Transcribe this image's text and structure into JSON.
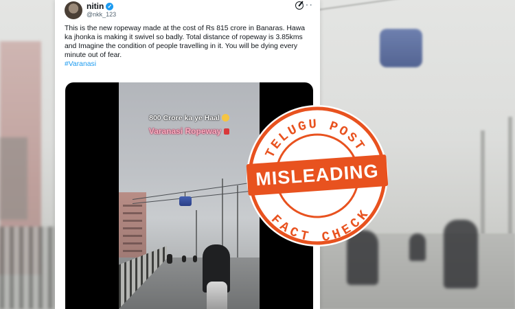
{
  "tweet": {
    "author_name": "nitin",
    "author_handle": "@nkk_123",
    "body": "This is the new ropeway made at the cost of Rs 815 crore in Banaras. Hawa ka jhonka is making it swivel so badly. Total distance of ropeway is 3.85kms and Imagine the condition of people travelling in it. You will be dying every minute out of fear.",
    "hashtag": "#Varanasi",
    "icons": {
      "verified": "verified-badge-icon",
      "grok": "grok-icon",
      "more": "more-options-icon"
    }
  },
  "video": {
    "caption_line1": "800 Crore ka ye Haal",
    "caption_line2": "Varanasi Ropeway",
    "caption_line1_emoji": "smile-emoji-icon",
    "caption_line2_emoji": "aerial-tramway-icon"
  },
  "stamp": {
    "top_text": "TELUGU POST",
    "main_label": "MISLEADING",
    "bottom_text": "FACT CHECK",
    "color": "#e8521f"
  },
  "colors": {
    "link": "#1d9bf0",
    "stamp_orange": "#e8521f"
  }
}
